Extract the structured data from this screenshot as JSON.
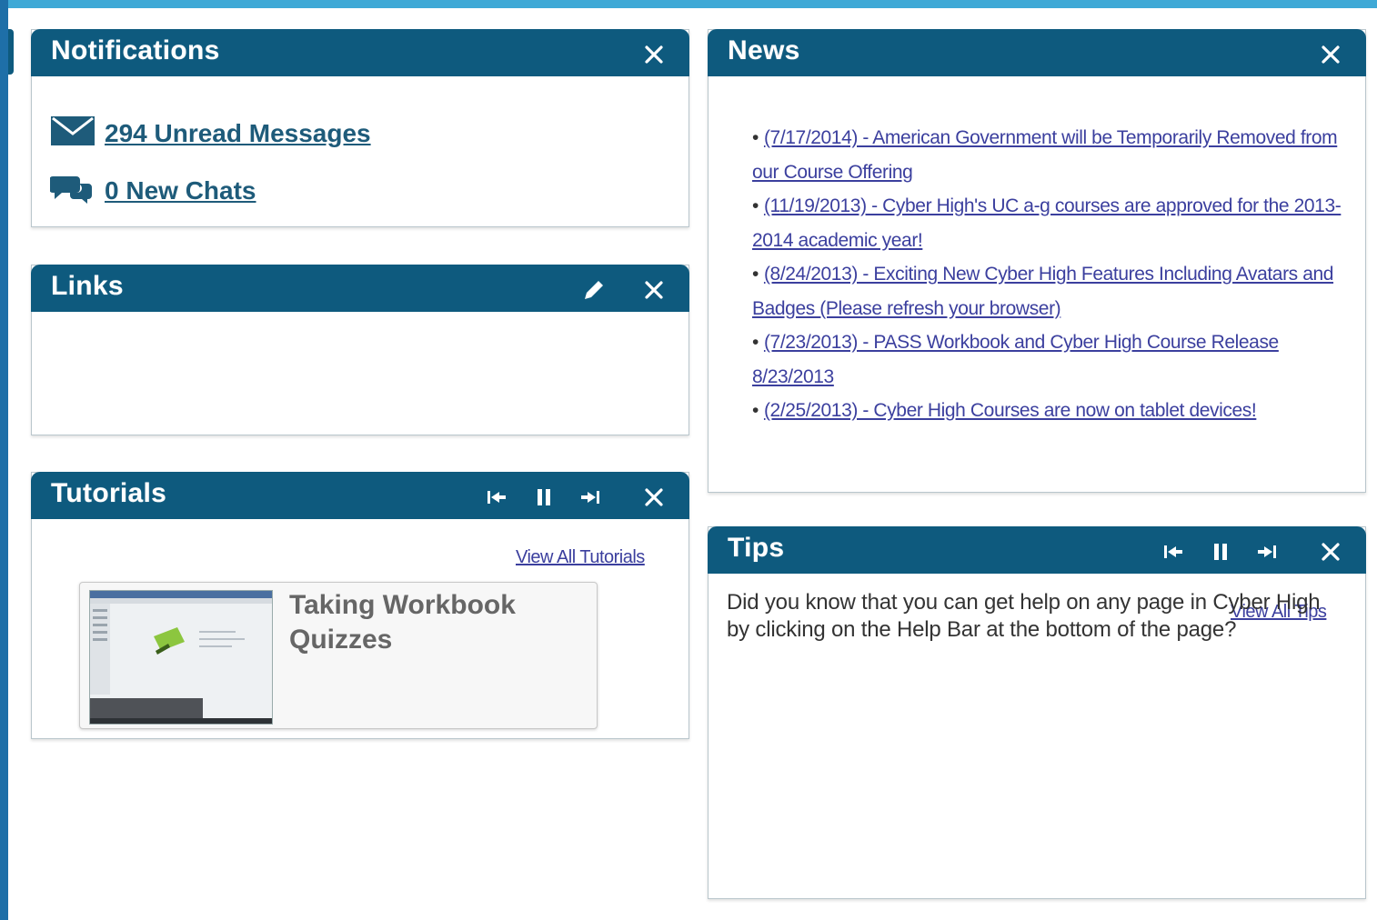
{
  "theme": {
    "header_bg": "#0e5a7e",
    "link_color": "#3b3f9e",
    "accent_top": "#3fa9d6"
  },
  "notifications": {
    "title": "Notifications",
    "unread_messages": "294 Unread Messages",
    "new_chats": "0 New Chats",
    "icons": [
      "envelope-icon",
      "chat-bubbles-icon",
      "close-icon"
    ]
  },
  "links": {
    "title": "Links",
    "icons": [
      "pencil-icon",
      "close-icon"
    ]
  },
  "tutorials": {
    "title": "Tutorials",
    "view_all": "View All Tutorials",
    "card_title": "Taking Workbook Quizzes",
    "icons": [
      "skip-back-icon",
      "pause-icon",
      "skip-forward-icon",
      "close-icon"
    ]
  },
  "news": {
    "title": "News",
    "items": [
      {
        "text": "(7/17/2014) - American Government will be Temporarily Removed from our Course Offering"
      },
      {
        "text": "(11/19/2013) - Cyber High's UC a-g courses are approved for the 2013-2014 academic year!"
      },
      {
        "text": "(8/24/2013) - Exciting New Cyber High Features Including Avatars and Badges (Please refresh your browser)"
      },
      {
        "text": "(7/23/2013) - PASS Workbook and Cyber High Course Release 8/23/2013"
      },
      {
        "text": "(2/25/2013) - Cyber High Courses are now on tablet devices!"
      }
    ],
    "icons": [
      "close-icon"
    ]
  },
  "tips": {
    "title": "Tips",
    "view_all": "View All Tips",
    "text": "Did you know that you can get help on any page in Cyber High by clicking on the Help Bar at the bottom of the page?",
    "icons": [
      "skip-back-icon",
      "pause-icon",
      "skip-forward-icon",
      "close-icon"
    ]
  }
}
